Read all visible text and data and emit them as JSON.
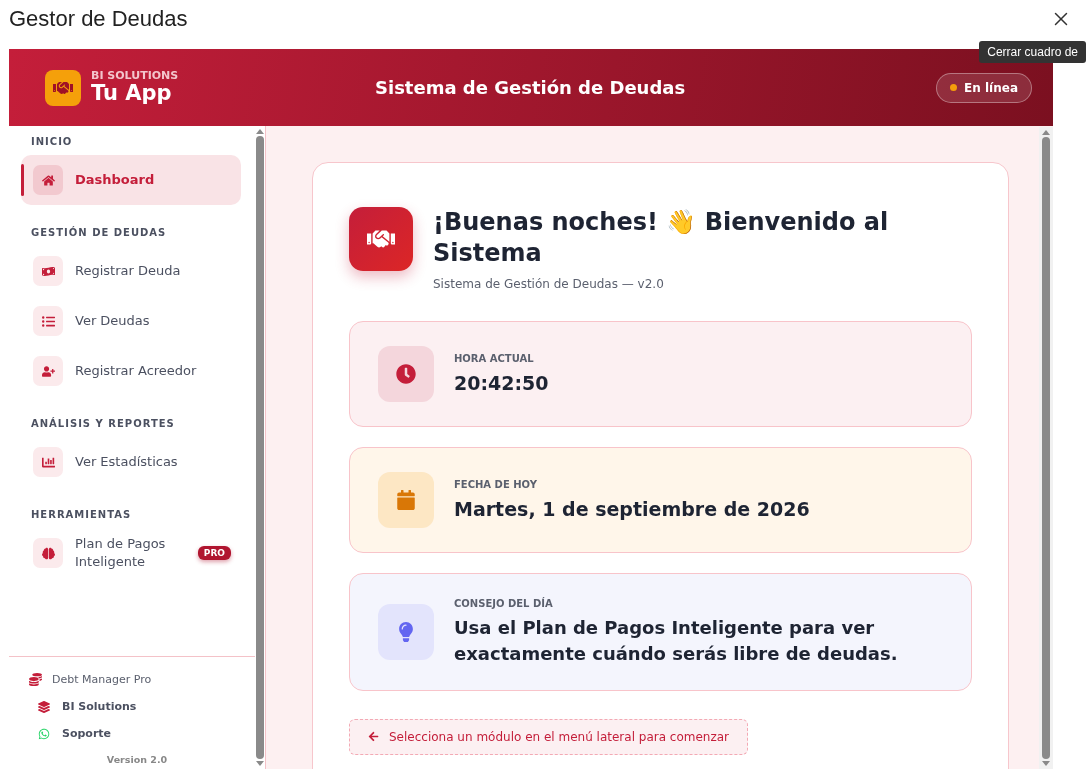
{
  "window": {
    "title": "Gestor de Deudas",
    "tooltip": "Cerrar cuadro de"
  },
  "header": {
    "brand_small": "BI SOLUTIONS",
    "brand": "Tu App",
    "title": "Sistema de Gestión de Deudas",
    "status": {
      "label": "En línea",
      "online": true
    }
  },
  "sidebar": {
    "sections": [
      {
        "title": "INICIO",
        "items": [
          {
            "label": "Dashboard",
            "selected": true
          }
        ]
      },
      {
        "title": "GESTIÓN DE DEUDAS",
        "items": [
          {
            "label": "Registrar Deuda",
            "selected": false
          },
          {
            "label": "Ver Deudas",
            "selected": false
          },
          {
            "label": "Registrar Acreedor",
            "selected": false
          }
        ]
      },
      {
        "title": "ANÁLISIS Y REPORTES",
        "items": [
          {
            "label": "Ver Estadísticas",
            "selected": false
          }
        ]
      },
      {
        "title": "HERRAMIENTAS",
        "items": [
          {
            "label": "Plan de Pagos Inteligente",
            "selected": false,
            "badge": "PRO"
          }
        ]
      }
    ],
    "footer": {
      "product": "Debt Manager Pro",
      "links": [
        {
          "kind": "company",
          "label": "BI Solutions"
        },
        {
          "kind": "support",
          "label": "Soporte"
        }
      ],
      "version": "Version 2.0"
    }
  },
  "welcome": {
    "title": "¡Buenas noches! 👋 Bienvenido al Sistema",
    "subtitle": "Sistema de Gestión de Deudas — v2.0",
    "cards": [
      {
        "kind": "time",
        "label": "HORA ACTUAL",
        "value": "20:42:50"
      },
      {
        "kind": "date",
        "label": "FECHA DE HOY",
        "value": "Martes, 1 de septiembre de 2026"
      },
      {
        "kind": "tip",
        "label": "CONSEJO DEL DÍA",
        "value": "Usa el Plan de Pagos Inteligente para ver exactamente cuándo serás libre de deudas."
      }
    ],
    "hint": "Selecciona un módulo en el menú lateral para comenzar"
  }
}
